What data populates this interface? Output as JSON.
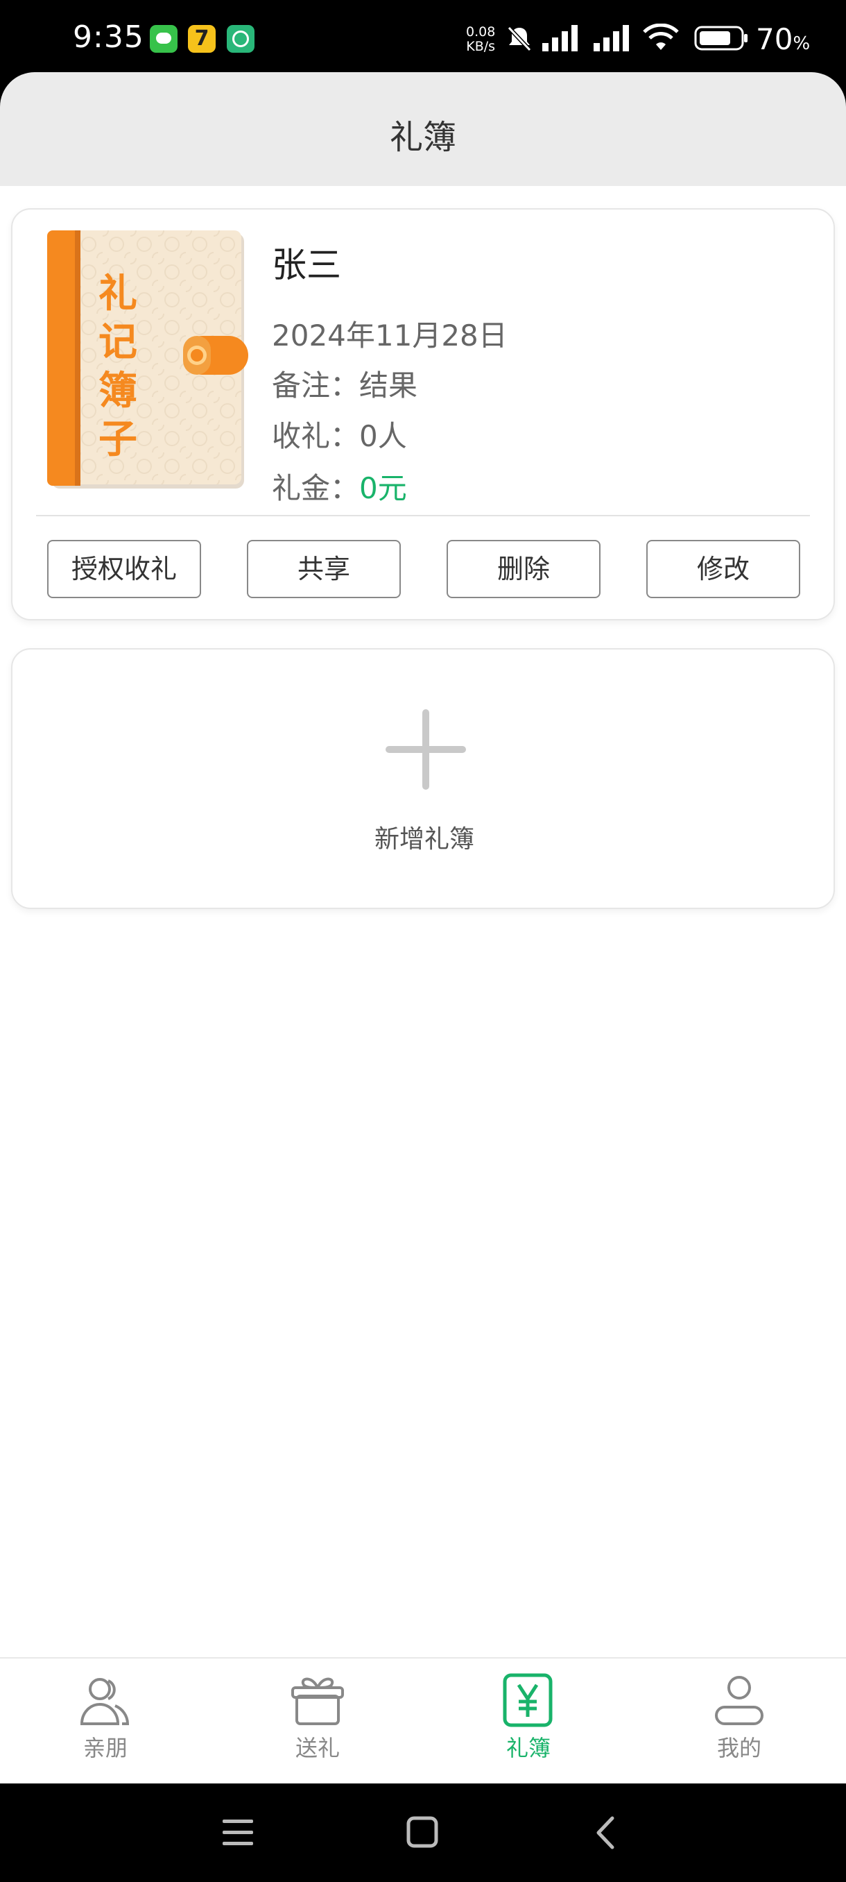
{
  "status_bar": {
    "time": "9:35",
    "net_speed_value": "0.08",
    "net_speed_unit": "KB/s",
    "battery": "70",
    "battery_unit": "%"
  },
  "header": {
    "title": "礼簿"
  },
  "book": {
    "cover_text": [
      "礼",
      "记",
      "簿",
      "子"
    ],
    "name": "张三",
    "date": "2024年11月28日",
    "note_label": "备注：",
    "note_value": "结果",
    "received_label": "收礼：",
    "received_value": "0人",
    "money_label": "礼金：",
    "money_value": "0元",
    "actions": [
      "授权收礼",
      "共享",
      "删除",
      "修改"
    ]
  },
  "add_book": {
    "label": "新增礼簿"
  },
  "tabbar": {
    "items": [
      {
        "label": "亲朋",
        "icon": "friends-icon"
      },
      {
        "label": "送礼",
        "icon": "gift-icon"
      },
      {
        "label": "礼簿",
        "icon": "yen-book-icon"
      },
      {
        "label": "我的",
        "icon": "profile-icon"
      }
    ],
    "active_index": 2
  },
  "colors": {
    "accent": "#19b36a",
    "cover_orange": "#f5891f"
  }
}
